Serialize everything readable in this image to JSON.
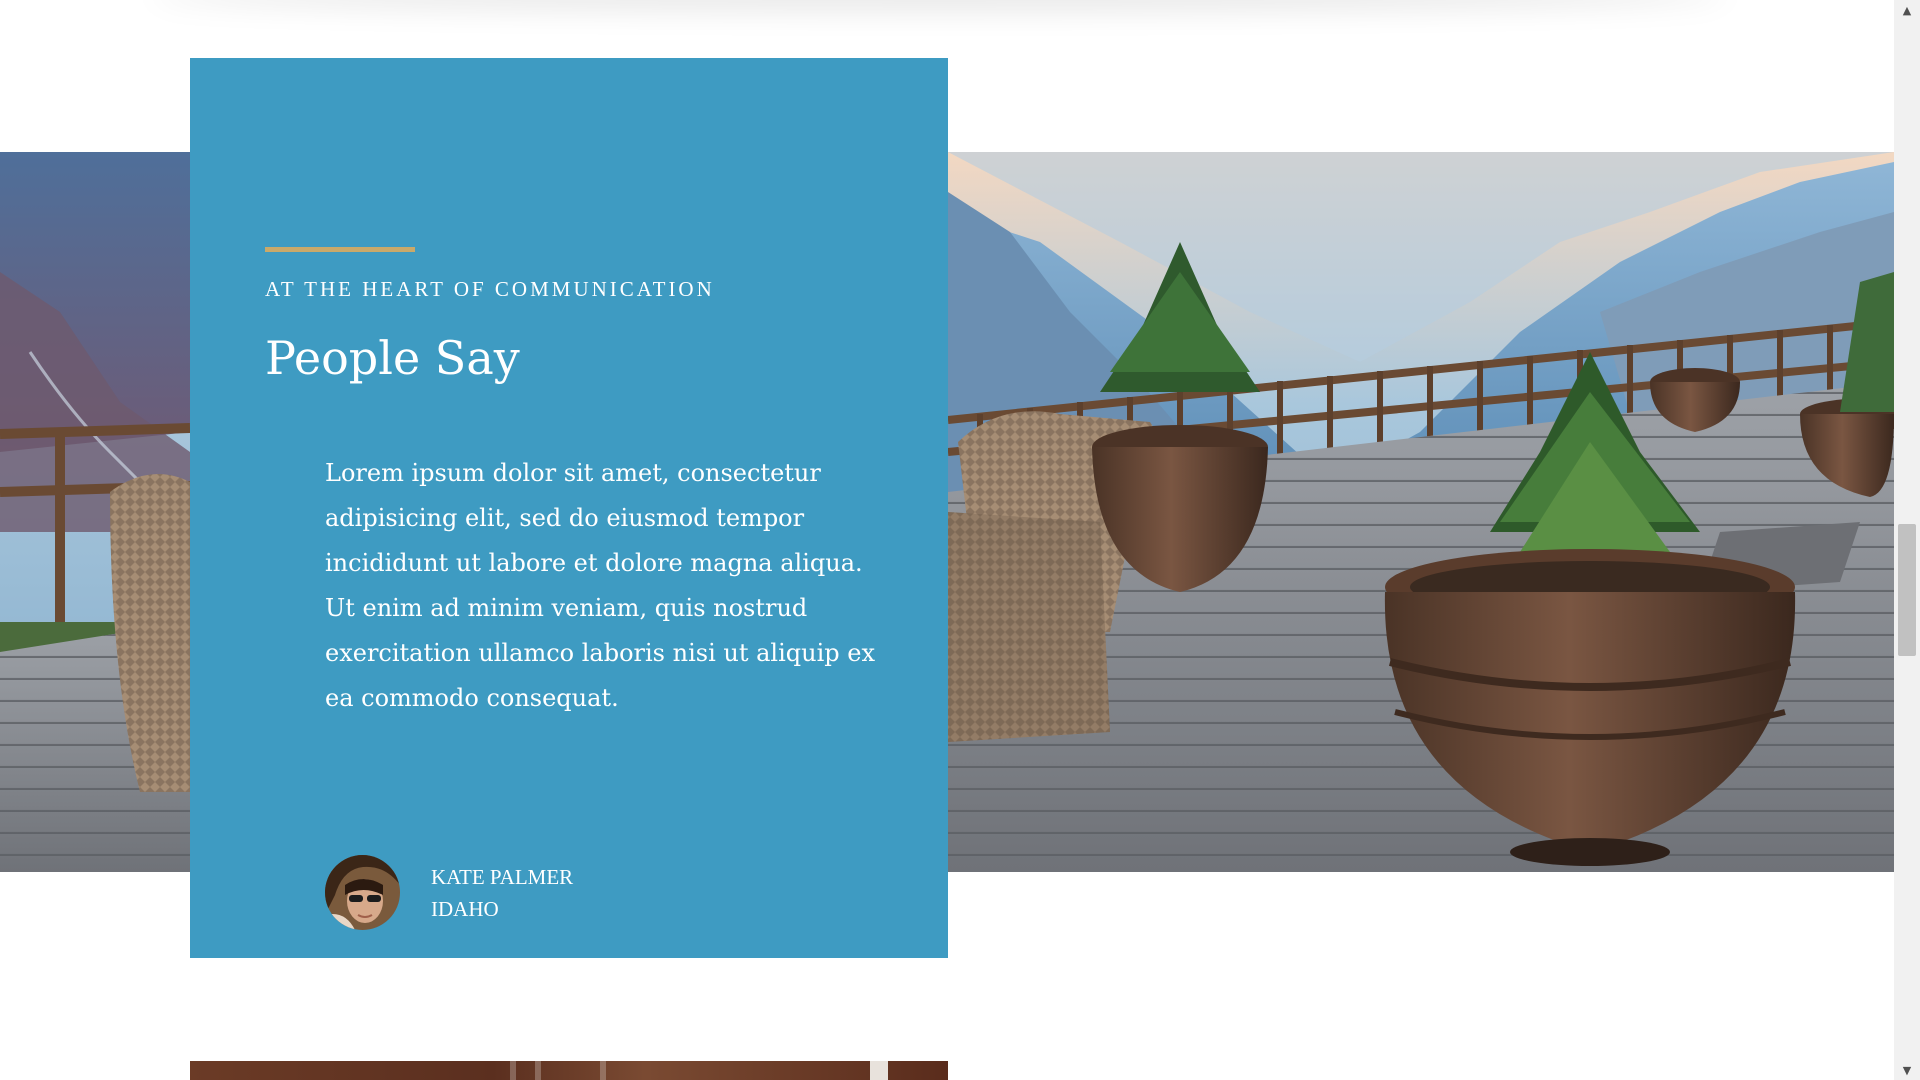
{
  "testimonial": {
    "kicker": "AT THE HEART OF COMMUNICATION",
    "title": "People Say",
    "quote": "Lorem ipsum dolor sit amet, consectetur adipisicing elit, sed do eiusmod tempor incididunt ut labore et dolore magna aliqua. Ut enim ad minim veniam, quis nostrud exercitation ullamco laboris nisi ut aliquip ex ea commodo consequat.",
    "author_name": "KATE PALMER",
    "author_location": "IDAHO"
  },
  "colors": {
    "card_background": "#3e9bc2",
    "accent_rule": "#c9a96a",
    "text": "#ffffff"
  },
  "scrollbar": {
    "up_icon": "triangle-up-icon",
    "down_icon": "triangle-down-icon"
  }
}
